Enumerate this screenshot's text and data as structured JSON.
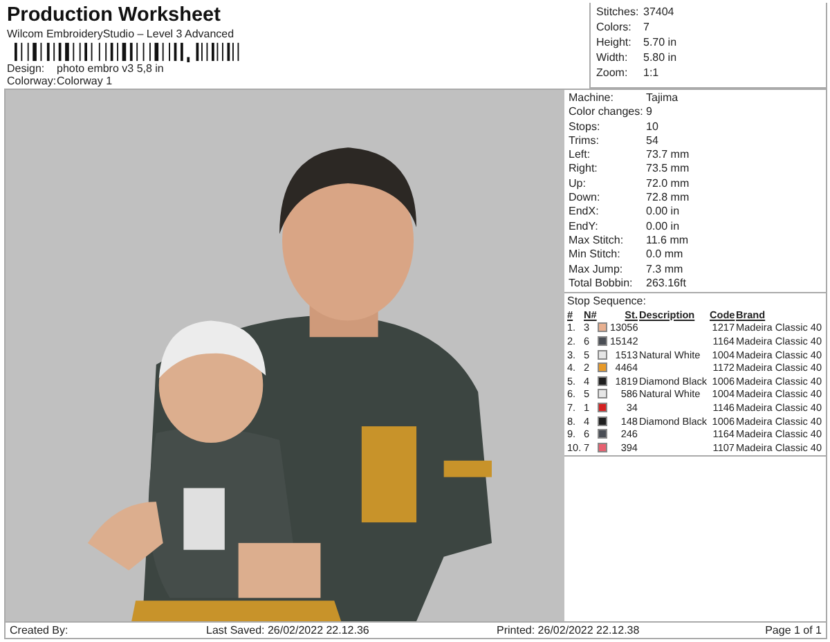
{
  "header": {
    "title": "Production Worksheet",
    "subtitle": "Wilcom EmbroideryStudio – Level 3 Advanced",
    "design_label": "Design:",
    "design": "photo embro v3 5,8 in",
    "colorway_label": "Colorway:",
    "colorway": "Colorway 1"
  },
  "stats": [
    {
      "label": "Stitches:",
      "value": "37404"
    },
    {
      "label": "Colors:",
      "value": "7"
    },
    {
      "label": "Height:",
      "value": "5.70 in"
    },
    {
      "label": "Width:",
      "value": "5.80 in"
    },
    {
      "label": "Zoom:",
      "value": "1:1"
    }
  ],
  "machine_info": [
    {
      "label": "Machine:",
      "value": "Tajima"
    },
    {
      "label": "Color changes:",
      "value": "9"
    },
    {
      "label": "Stops:",
      "value": "10"
    },
    {
      "label": "Trims:",
      "value": "54"
    },
    {
      "label": "Left:",
      "value": "73.7 mm"
    },
    {
      "label": "Right:",
      "value": "73.5 mm"
    },
    {
      "label": "Up:",
      "value": "72.0 mm"
    },
    {
      "label": "Down:",
      "value": "72.8 mm"
    },
    {
      "label": "EndX:",
      "value": "0.00 in"
    },
    {
      "label": "EndY:",
      "value": "0.00 in"
    },
    {
      "label": "Max Stitch:",
      "value": "11.6 mm"
    },
    {
      "label": "Min Stitch:",
      "value": "0.0 mm"
    },
    {
      "label": "Max Jump:",
      "value": "7.3 mm"
    },
    {
      "label": "Total Bobbin:",
      "value": "263.16ft"
    }
  ],
  "stop_sequence": {
    "title": "Stop Sequence:",
    "columns": [
      "#",
      "N#",
      "St.",
      "Description",
      "Code",
      "Brand"
    ],
    "rows": [
      {
        "index": "1.",
        "needle": "3",
        "color": "#e8b090",
        "stitches": "13056",
        "code": "1217",
        "brand": "Madeira Classic 40"
      },
      {
        "index": "2.",
        "needle": "6",
        "color": "#4a4e55",
        "stitches": "15142",
        "code": "1164",
        "brand": "Madeira Classic 40"
      },
      {
        "index": "3.",
        "needle": "5",
        "color": "#e6e6e6",
        "stitches": "1513",
        "description": "Natural White",
        "code": "1004",
        "brand": "Madeira Classic 40"
      },
      {
        "index": "4.",
        "needle": "2",
        "color": "#e89a28",
        "stitches": "4464",
        "code": "1172",
        "brand": "Madeira Classic 40"
      },
      {
        "index": "5.",
        "needle": "4",
        "color": "#1e1e1e",
        "stitches": "1819",
        "description": "Diamond Black",
        "code": "1006",
        "brand": "Madeira Classic 40"
      },
      {
        "index": "6.",
        "needle": "5",
        "color": "#e6e6e6",
        "stitches": "586",
        "description": "Natural White",
        "code": "1004",
        "brand": "Madeira Classic 40"
      },
      {
        "index": "7.",
        "needle": "1",
        "color": "#d42020",
        "stitches": "34",
        "code": "1146",
        "brand": "Madeira Classic 40"
      },
      {
        "index": "8.",
        "needle": "4",
        "color": "#1e1e1e",
        "stitches": "148",
        "description": "Diamond Black",
        "code": "1006",
        "brand": "Madeira Classic 40"
      },
      {
        "index": "9.",
        "needle": "6",
        "color": "#4a4e55",
        "stitches": "246",
        "code": "1164",
        "brand": "Madeira Classic 40"
      },
      {
        "index": "10.",
        "needle": "7",
        "color": "#e86070",
        "stitches": "394",
        "code": "1107",
        "brand": "Madeira Classic 40"
      }
    ]
  },
  "preview": {
    "kind": "picture"
  },
  "footer": [
    "Created By:",
    "Last Saved: 26/02/2022 22.12.36",
    "Printed: 26/02/2022 22.12.38",
    "Page 1 of 1"
  ]
}
